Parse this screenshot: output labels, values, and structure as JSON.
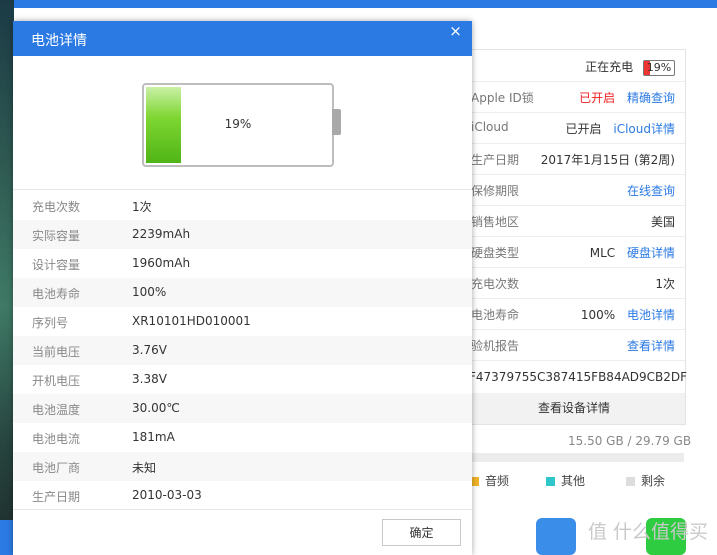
{
  "dialog": {
    "title": "电池详情",
    "close_glyph": "×",
    "battery_percent": "19%",
    "battery_level": 0.19,
    "rows": [
      {
        "label": "充电次数",
        "value": "1次"
      },
      {
        "label": "实际容量",
        "value": "2239mAh"
      },
      {
        "label": "设计容量",
        "value": "1960mAh"
      },
      {
        "label": "电池寿命",
        "value": "100%"
      },
      {
        "label": "序列号",
        "value": "XR10101HD010001"
      },
      {
        "label": "当前电压",
        "value": "3.76V"
      },
      {
        "label": "开机电压",
        "value": "3.38V"
      },
      {
        "label": "电池温度",
        "value": "30.00℃"
      },
      {
        "label": "电池电流",
        "value": "181mA"
      },
      {
        "label": "电池厂商",
        "value": "未知"
      },
      {
        "label": "生产日期",
        "value": "2010-03-03"
      }
    ],
    "ok_label": "确定"
  },
  "device_info": {
    "charging_label": "正在充电",
    "charging_percent": "19%",
    "apple_id_label": "Apple ID锁",
    "apple_id_status": "已开启",
    "apple_id_link": "精确查询",
    "icloud_label": "iCloud",
    "icloud_status": "已开启",
    "icloud_link": "iCloud详情",
    "mfg_date_label": "生产日期",
    "mfg_date_value": "2017年1月15日 (第2周)",
    "warranty_label": "保修期限",
    "warranty_link": "在线查询",
    "region_label": "销售地区",
    "region_value": "美国",
    "disk_label": "硬盘类型",
    "disk_value": "MLC",
    "disk_link": "硬盘详情",
    "charge_count_label": "充电次数",
    "charge_count_value": "1次",
    "battery_life_label": "电池寿命",
    "battery_life_value": "100%",
    "battery_life_link": "电池详情",
    "report_label": "验机报告",
    "report_link": "查看详情",
    "serial_value": "F47379755C387415FB84AD9CB2DF",
    "view_details_button": "查看设备详情"
  },
  "storage": {
    "text": "15.50 GB / 29.79 GB",
    "legend": [
      {
        "label": "音频",
        "color": "#f0b429"
      },
      {
        "label": "其他",
        "color": "#2ec7c9"
      },
      {
        "label": "剩余",
        "color": "#dddddd"
      }
    ]
  },
  "watermark": "值 什么值得买",
  "colors": {
    "accent": "#2b7ae3",
    "battery_green": "#5cc41e",
    "status_red": "#e22222"
  }
}
